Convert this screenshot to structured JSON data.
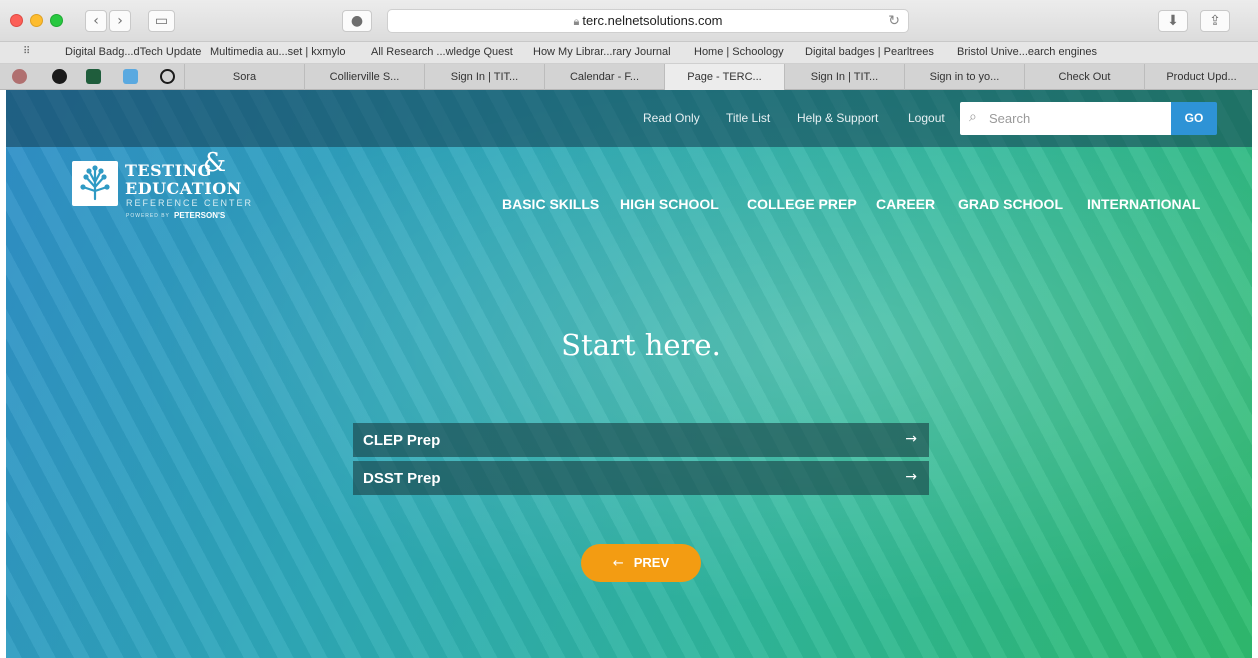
{
  "browser": {
    "url": "terc.nelnetsolutions.com",
    "bookmarks": [
      "Digital Badg...dTech Update",
      "Multimedia au...set | kxmylo",
      "All Research ...wledge Quest",
      "How My Librar...rary Journal",
      "Home | Schoology",
      "Digital badges | Pearltrees",
      "Bristol Unive...earch engines"
    ],
    "tabs": [
      "Sora",
      "Collierville S...",
      "Sign In | TIT...",
      "Calendar - F...",
      "Page - TERC...",
      "Sign In | TIT...",
      "Sign in to yo...",
      "Check Out",
      "Product Upd..."
    ],
    "active_tab_index": 4
  },
  "utility_nav": {
    "links": [
      "Read Only",
      "Title List",
      "Help & Support",
      "Logout"
    ],
    "search_placeholder": "Search",
    "go_label": "GO"
  },
  "logo": {
    "line1": "TESTING",
    "amp": "&",
    "line2": "EDUCATION",
    "line3": "REFERENCE CENTER",
    "powered": "POWERED BY",
    "brand": "PETERSON'S"
  },
  "main_nav": [
    "BASIC SKILLS",
    "HIGH SCHOOL",
    "COLLEGE PREP",
    "CAREER",
    "GRAD SCHOOL",
    "INTERNATIONAL"
  ],
  "content": {
    "headline": "Start here.",
    "options": [
      "CLEP Prep",
      "DSST Prep"
    ],
    "prev_label": "PREV"
  },
  "colors": {
    "go_button": "#2e93d6",
    "prev_button": "#f39c12",
    "gradient_start": "#2f8fc8",
    "gradient_end": "#2fbb6e"
  }
}
